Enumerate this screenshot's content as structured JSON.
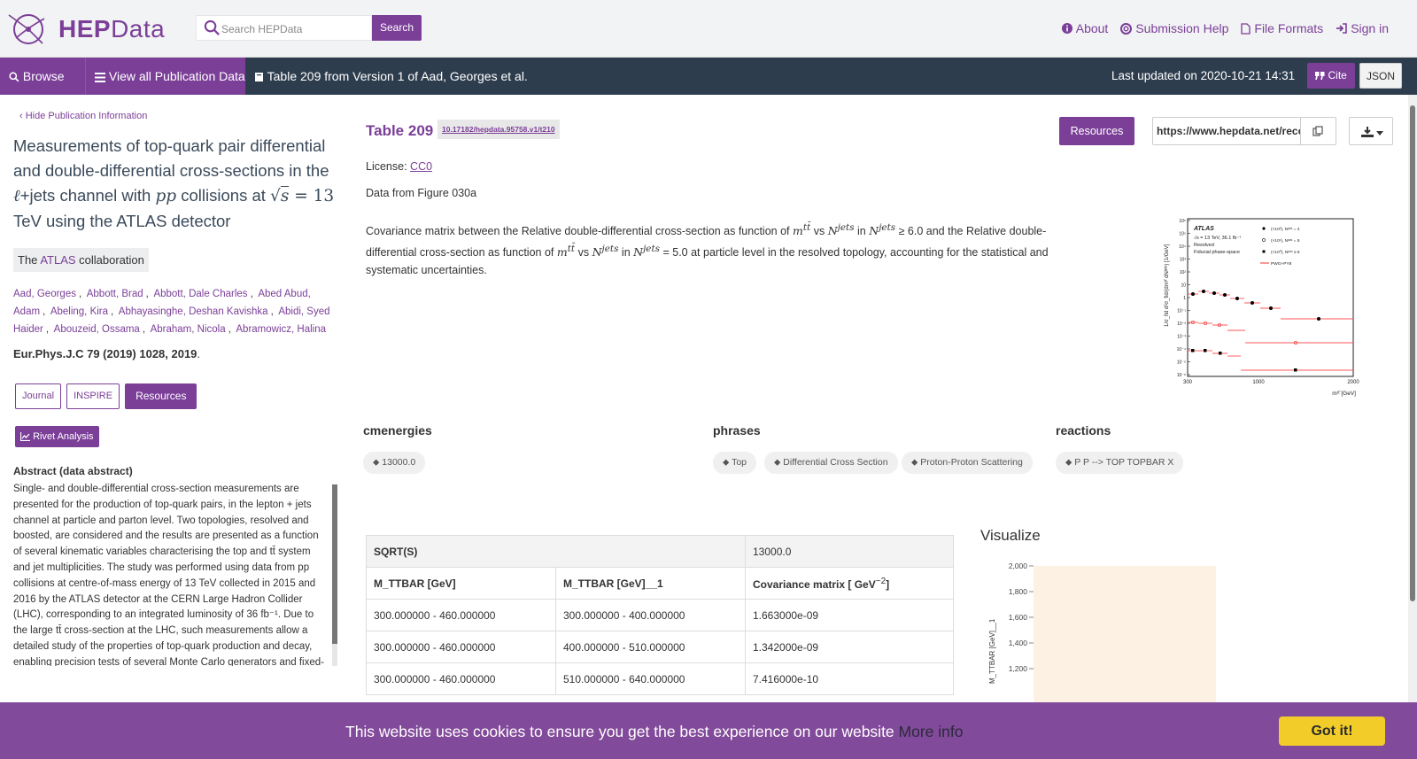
{
  "header": {
    "logo": {
      "brand_bold": "HEP",
      "brand_rest": "Data"
    },
    "search": {
      "placeholder": "Search HEPData",
      "button": "Search"
    },
    "links": [
      {
        "icon": "info-circle-icon",
        "label": "About"
      },
      {
        "icon": "life-ring-icon",
        "label": "Submission Help"
      },
      {
        "icon": "file-icon",
        "label": "File Formats"
      },
      {
        "icon": "sign-in-icon",
        "label": "Sign in"
      }
    ]
  },
  "navbar": {
    "browse": "Browse all",
    "view_all": "View all Publication Data",
    "table_label": "Table 209 from Version 1 of Aad, Georges et al.",
    "updated": "Last updated on 2020-10-21 14:31",
    "cite": "Cite",
    "json": "JSON"
  },
  "publication": {
    "hide_label": "Hide Publication Information",
    "title_line1": "Measurements of top-quark pair differential",
    "title_line2": "and double-differential cross-sections in the",
    "title_l": "ℓ",
    "title_line3_mid": "+jets channel with",
    "title_pp": "pp",
    "title_line3_end": "collisions at",
    "title_sqrt": "s",
    "title_eq": "= 13",
    "title_line4": "TeV using the ATLAS detector",
    "collab_pre": "The",
    "collab_link": "ATLAS",
    "collab_post": "collaboration",
    "authors": [
      "Aad, Georges",
      "Abbott, Brad",
      "Abbott, Dale Charles",
      "Abed Abud, Adam",
      "Abeling, Kira",
      "Abhayasinghe, Deshan Kavishka",
      "Abidi, Syed Haider",
      "Abouzeid, Ossama",
      "Abraham, Nicola",
      "Abramowicz, Halina"
    ],
    "journal": "Eur.Phys.J.C 79 (2019) 1028, 2019",
    "buttons": {
      "journal": "Journal",
      "inspire": "INSPIRE",
      "resources": "Resources"
    },
    "rivet": "Rivet Analysis",
    "abstract_title": "Abstract (data abstract)",
    "abstract": "Single- and double-differential cross-section measurements are presented for the production of top-quark pairs, in the lepton + jets channel at particle and parton level. Two topologies, resolved and boosted, are considered and the results are presented as a function of several kinematic variables characterising the top and tt̄ system and jet multiplicities. The study was performed using data from pp collisions at centre-of-mass energy of 13 TeV collected in 2015 and 2016 by the ATLAS detector at the CERN Large Hadron Collider (LHC), corresponding to an integrated luminosity of 36 fb⁻¹. Due to the large tt̄ cross-section at the LHC, such measurements allow a detailed study of the properties of top-quark production and decay, enabling precision tests of several Monte Carlo generators and fixed-"
  },
  "table": {
    "title": "Table 209",
    "doi": "10.17182/hepdata.95758.v1/t210",
    "resources_btn": "Resources",
    "url": "https://www.hepdata.net/reco",
    "license_label": "License:",
    "license_link": "CC0",
    "data_from": "Data from Figure 030a",
    "description_parts": {
      "p1": "Covariance matrix between the  Relative double-differential cross-section as function of",
      "p2": "vs",
      "p3": "in",
      "p4": "≥ 6.0 and the Relative double-differential cross-section as function of",
      "p5": "vs",
      "p6": "in",
      "p7": "= 5.0 at particle level in the resolved topology, accounting for the statistical and systematic uncertainties.",
      "m": "m",
      "tt": "tt̄",
      "N": "N",
      "jets": "jets"
    },
    "keywords": {
      "cmenergies": {
        "title": "cmenergies",
        "tags": [
          "13000.0"
        ]
      },
      "phrases": {
        "title": "phrases",
        "tags": [
          "Top",
          "Differential Cross Section",
          "Proton-Proton Scattering"
        ]
      },
      "reactions": {
        "title": "reactions",
        "tags": [
          "P P --> TOP TOPBAR X"
        ]
      }
    },
    "sqrts_label": "SQRT(S)",
    "sqrts_value": "13000.0",
    "columns": [
      "M_TTBAR [GeV]",
      "M_TTBAR [GeV]__1",
      "Covariance matrix [ GeV"
    ],
    "cov_unit_exp": "−2",
    "cov_unit_close": "]",
    "rows": [
      [
        "300.000000 - 460.000000",
        "300.000000 - 400.000000",
        "1.663000e-09"
      ],
      [
        "300.000000 - 460.000000",
        "400.000000 - 510.000000",
        "1.342000e-09"
      ],
      [
        "300.000000 - 460.000000",
        "510.000000 - 640.000000",
        "7.416000e-10"
      ]
    ],
    "visualize": "Visualize",
    "viz_ylabel": "M_TTBAR [GeV]__1",
    "viz_ticks": [
      "2,000",
      "1,800",
      "1,600",
      "1,400",
      "1,200"
    ]
  },
  "thumbnail": {
    "atlas": "ATLAS",
    "lines": [
      "√s = 13 TeV, 36.1 fb⁻¹",
      "Resolved",
      "Fiducial phase-space"
    ],
    "legend": [
      "(×10³), Nʲᵉᵗˢ = 4",
      "(×10¹), Nʲᵉᵗˢ = 5",
      "(×10⁰), Nʲᵉᵗˢ ≥ 6",
      "PWG+PY8"
    ],
    "xticks": [
      "300",
      "1000",
      "2000"
    ],
    "xlabel": "mᵗᵗ̄ [GeV]",
    "ylabel": "1/σ_fid d²σ_fid/(dmᵗᵗ̄ dNʲᵉᵗˢ) [1/GeV]",
    "yticks": [
      "10⁶",
      "10⁵",
      "10⁴",
      "10³",
      "10²",
      "10",
      "1",
      "10⁻¹",
      "10⁻²",
      "10⁻³",
      "10⁻⁴",
      "10⁻⁵",
      "10⁻⁶"
    ]
  },
  "cookie": {
    "text": "This website uses cookies to ensure you get the best experience on our website",
    "more": "More info",
    "button": "Got it!"
  },
  "colors": {
    "brand": "#7b3f98",
    "navbar": "#2e3d4e",
    "cookie_bg": "#824a9a",
    "cookie_btn": "#f2cd2a",
    "viz_fill": "#fdf1e4"
  }
}
